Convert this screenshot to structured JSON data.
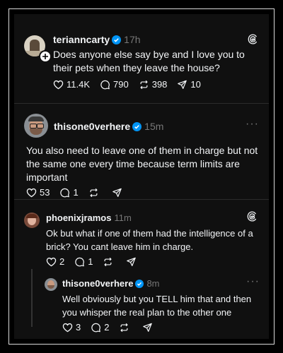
{
  "posts": [
    {
      "username": "terianncarty",
      "time": "17h",
      "text": "Does anyone else say bye and I love you to their pets when they leave the house?",
      "likes": "11.4K",
      "replies": "790",
      "reposts": "398",
      "shares": "10"
    },
    {
      "username": "thisone0verhere",
      "time": "15m",
      "text": "You also need to leave one of them in charge but not the same one every time because term limits are important",
      "likes": "53",
      "replies": "1"
    },
    {
      "username": "phoenixjramos",
      "time": "11m",
      "text": "Ok but what if one of them had the intelligence of a brick? You cant leave him in charge.",
      "likes": "2",
      "replies": "1"
    },
    {
      "username": "thisone0verhere",
      "time": "8m",
      "text": "Well obviously but you TELL him that and then you whisper the real plan to the other one",
      "likes": "3",
      "replies": "2"
    }
  ],
  "colors": {
    "background": "#101010",
    "text": "#f3f5f7",
    "muted": "#777777",
    "verified": "#0095f6"
  },
  "icons": [
    "heart-icon",
    "comment-icon",
    "repost-icon",
    "share-icon",
    "verified-icon",
    "threads-logo-icon",
    "more-icon",
    "follow-plus-icon"
  ]
}
